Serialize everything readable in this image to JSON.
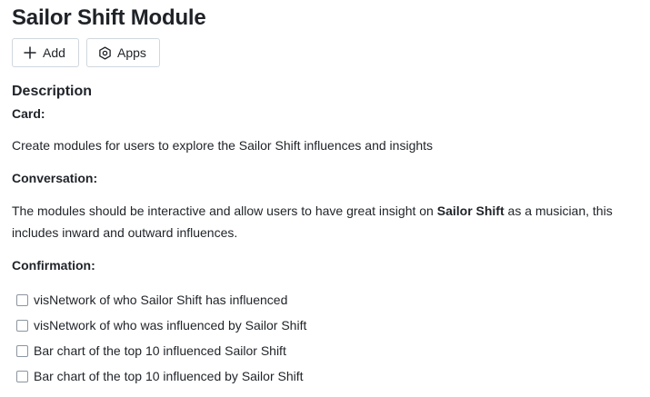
{
  "page": {
    "title": "Sailor Shift Module"
  },
  "toolbar": {
    "add_label": "Add",
    "add_icon": "plus-icon",
    "apps_label": "Apps",
    "apps_icon": "hexagon-apps-icon"
  },
  "description": {
    "heading": "Description",
    "card_label": "Card:",
    "card_text": "Create modules for users to explore the Sailor Shift influences and insights",
    "conversation_label": "Conversation:",
    "conversation_text_before": "The modules should be interactive and allow users to have great insight on ",
    "conversation_text_bold": "Sailor Shift",
    "conversation_text_after": " as a musician, this includes inward and outward influences.",
    "confirmation_label": "Confirmation:",
    "confirmation_items": [
      {
        "label": "visNetwork of who Sailor Shift has influenced",
        "checked": false
      },
      {
        "label": "visNetwork of who was influenced by Sailor Shift",
        "checked": false
      },
      {
        "label": "Bar chart of the top 10 influenced Sailor Shift",
        "checked": false
      },
      {
        "label": "Bar chart of the top 10 influenced by Sailor Shift",
        "checked": false
      }
    ]
  }
}
